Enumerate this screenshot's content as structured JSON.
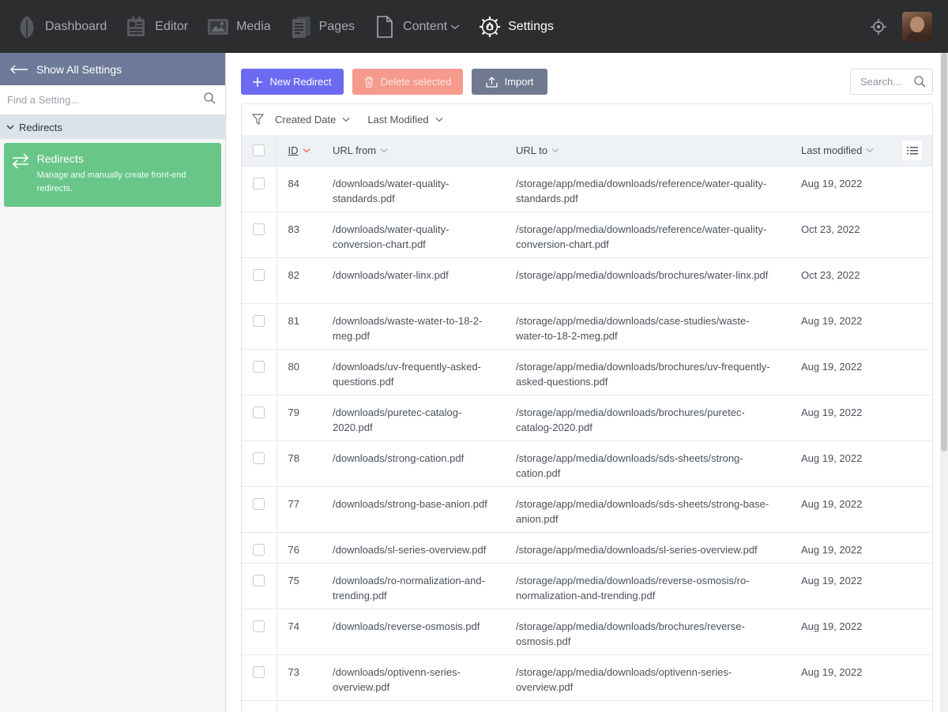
{
  "nav": {
    "items": [
      {
        "label": "Dashboard",
        "icon": "leaf-icon"
      },
      {
        "label": "Editor",
        "icon": "editor-icon"
      },
      {
        "label": "Media",
        "icon": "media-icon"
      },
      {
        "label": "Pages",
        "icon": "pages-icon"
      },
      {
        "label": "Content",
        "icon": "document-icon"
      },
      {
        "label": "Settings",
        "icon": "gear-icon"
      }
    ],
    "active": "Settings"
  },
  "sidebar": {
    "show_all": "Show All Settings",
    "find_placeholder": "Find a Setting...",
    "group": "Redirects",
    "card": {
      "title": "Redirects",
      "description": "Manage and manually create front-end redirects."
    }
  },
  "toolbar": {
    "new_label": "New Redirect",
    "delete_label": "Delete selected",
    "import_label": "Import",
    "search_placeholder": "Search..."
  },
  "filters": {
    "created": "Created Date",
    "modified": "Last Modified"
  },
  "table": {
    "headers": {
      "id": "ID",
      "from": "URL from",
      "to": "URL to",
      "modified": "Last modified"
    },
    "rows": [
      {
        "id": "84",
        "from": "/downloads/water-quality-standards.pdf",
        "to": "/storage/app/media/downloads/reference/water-quality-standards.pdf",
        "modified": "Aug 19, 2022"
      },
      {
        "id": "83",
        "from": "/downloads/water-quality-conversion-chart.pdf",
        "to": "/storage/app/media/downloads/reference/water-quality-conversion-chart.pdf",
        "modified": "Oct 23, 2022"
      },
      {
        "id": "82",
        "from": "/downloads/water-linx.pdf",
        "to": "/storage/app/media/downloads/brochures/water-linx.pdf",
        "modified": "Oct 23, 2022"
      },
      {
        "id": "81",
        "from": "/downloads/waste-water-to-18-2-meg.pdf",
        "to": "/storage/app/media/downloads/case-studies/waste-water-to-18-2-meg.pdf",
        "modified": "Aug 19, 2022"
      },
      {
        "id": "80",
        "from": "/downloads/uv-frequently-asked-questions.pdf",
        "to": "/storage/app/media/downloads/brochures/uv-frequently-asked-questions.pdf",
        "modified": "Aug 19, 2022"
      },
      {
        "id": "79",
        "from": "/downloads/puretec-catalog-2020.pdf",
        "to": "/storage/app/media/downloads/brochures/puretec-catalog-2020.pdf",
        "modified": "Aug 19, 2022"
      },
      {
        "id": "78",
        "from": "/downloads/strong-cation.pdf",
        "to": "/storage/app/media/downloads/sds-sheets/strong-cation.pdf",
        "modified": "Aug 19, 2022"
      },
      {
        "id": "77",
        "from": "/downloads/strong-base-anion.pdf",
        "to": "/storage/app/media/downloads/sds-sheets/strong-base-anion.pdf",
        "modified": "Aug 19, 2022"
      },
      {
        "id": "76",
        "from": "/downloads/sl-series-overview.pdf",
        "to": "/storage/app/media/downloads/sl-series-overview.pdf",
        "modified": "Aug 19, 2022"
      },
      {
        "id": "75",
        "from": "/downloads/ro-normalization-and-trending.pdf",
        "to": "/storage/app/media/downloads/reverse-osmosis/ro-normalization-and-trending.pdf",
        "modified": "Aug 19, 2022"
      },
      {
        "id": "74",
        "from": "/downloads/reverse-osmosis.pdf",
        "to": "/storage/app/media/downloads/brochures/reverse-osmosis.pdf",
        "modified": "Aug 19, 2022"
      },
      {
        "id": "73",
        "from": "/downloads/optivenn-series-overview.pdf",
        "to": "/storage/app/media/downloads/optivenn-series-overview.pdf",
        "modified": "Aug 19, 2022"
      }
    ]
  },
  "colors": {
    "topbar": "#2b2d2f",
    "primary": "#6d6af2",
    "danger": "#f59a8d",
    "secondary": "#6f7a91",
    "success": "#68c689",
    "sort_accent": "#e8734e"
  }
}
